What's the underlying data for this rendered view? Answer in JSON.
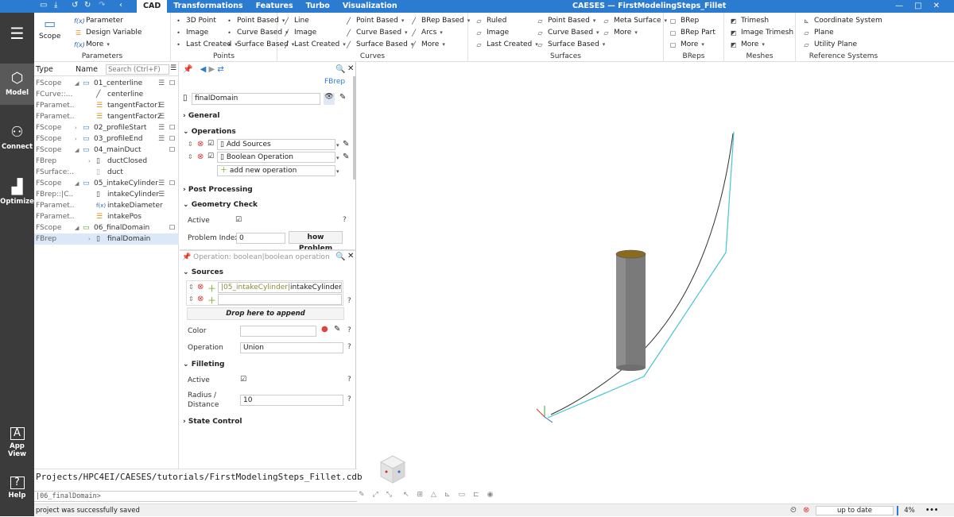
{
  "titlebar": {
    "tabs": [
      "CAD",
      "Transformations",
      "Features",
      "Turbo",
      "Visualization"
    ],
    "window_title": "CAESES — FirstModelingSteps_Fillet"
  },
  "ribbon": {
    "parameters": {
      "label": "Parameters",
      "scope": "Scope",
      "items": [
        "Parameter",
        "Design Variable",
        "More"
      ]
    },
    "points": {
      "label": "Points",
      "col1": [
        "3D Point",
        "Image",
        "Last Created"
      ],
      "col2": [
        "Point Based",
        "Curve Based",
        "Surface Based"
      ]
    },
    "curves": {
      "label": "Curves",
      "col1": [
        "Line",
        "Image",
        "Last Created"
      ],
      "col2": [
        "Point Based",
        "Curve Based",
        "Surface Based"
      ],
      "col3": [
        "BRep Based",
        "Arcs",
        "More"
      ]
    },
    "surfaces": {
      "label": "Surfaces",
      "col1": [
        "Ruled",
        "Image",
        "Last Created"
      ],
      "col2": [
        "Point Based",
        "Curve Based",
        "Surface Based"
      ],
      "col3": [
        "Meta Surface",
        "More"
      ]
    },
    "breps": {
      "label": "BReps",
      "items": [
        "BRep",
        "BRep Part",
        "More"
      ]
    },
    "meshes": {
      "label": "Meshes",
      "items": [
        "Trimesh",
        "Image Trimesh",
        "More"
      ]
    },
    "refsys": {
      "label": "Reference Systems",
      "items": [
        "Coordinate System",
        "Plane",
        "Utility Plane"
      ]
    }
  },
  "leftbar": {
    "model": "Model",
    "connect": "Connect",
    "optimize": "Optimize",
    "appview": "App View",
    "help": "Help"
  },
  "tree": {
    "header_type": "Type",
    "header_name": "Name",
    "search_placeholder": "Search (Ctrl+F)",
    "rows": [
      {
        "type": "FScope",
        "name": "01_centerline"
      },
      {
        "type": "FCurve::...",
        "name": "centerline"
      },
      {
        "type": "FParamet...",
        "name": "tangentFactor1"
      },
      {
        "type": "FParamet...",
        "name": "tangentFactor2"
      },
      {
        "type": "FScope",
        "name": "02_profileStart"
      },
      {
        "type": "FScope",
        "name": "03_profileEnd"
      },
      {
        "type": "FScope",
        "name": "04_mainDuct"
      },
      {
        "type": "FBrep",
        "name": "ductClosed"
      },
      {
        "type": "FSurface:...",
        "name": "duct"
      },
      {
        "type": "FScope",
        "name": "05_intakeCylinder"
      },
      {
        "type": "FBrep::|C...",
        "name": "intakeCylinder"
      },
      {
        "type": "FParamet...",
        "name": "intakeDiameter"
      },
      {
        "type": "FParamet...",
        "name": "intakePos"
      },
      {
        "type": "FScope",
        "name": "06_finalDomain"
      },
      {
        "type": "FBrep",
        "name": "finalDomain"
      }
    ]
  },
  "props": {
    "type_link": "FBrep",
    "object_name": "finalDomain",
    "general": "General",
    "operations": "Operations",
    "ops": [
      "Add Sources",
      "Boolean Operation",
      "add new operation"
    ],
    "post": "Post Processing",
    "geocheck": "Geometry Check",
    "active_label": "Active",
    "problem_label": "Problem Index",
    "problem_value": "0",
    "show_problem": "how Problem",
    "sub_title": "Operation: boolean|boolean operation",
    "sources": "Sources",
    "source_prefix": "|05_intakeCylinder|",
    "source_value": "intakeCylinder",
    "drop_here": "Drop here to append",
    "color_label": "Color",
    "operation_label": "Operation",
    "operation_value": "Union",
    "filleting": "Filleting",
    "fillet_active": "Active",
    "radius_label_1": "Radius /",
    "radius_label_2": "Distance",
    "radius_value": "10",
    "state_control": "State Control"
  },
  "bottom": {
    "path": "Projects/HPC4EI/CAESES/tutorials/FirstModelingSteps_Fillet.cdb",
    "cmd": "|06_finalDomain>",
    "status": "project was successfully saved",
    "uptodate": "up to date",
    "percent": "4%"
  },
  "colors": {
    "accent": "#2b7bd1",
    "leftbar": "#3b3b3b",
    "curve_cyan": "#43c6d4"
  }
}
